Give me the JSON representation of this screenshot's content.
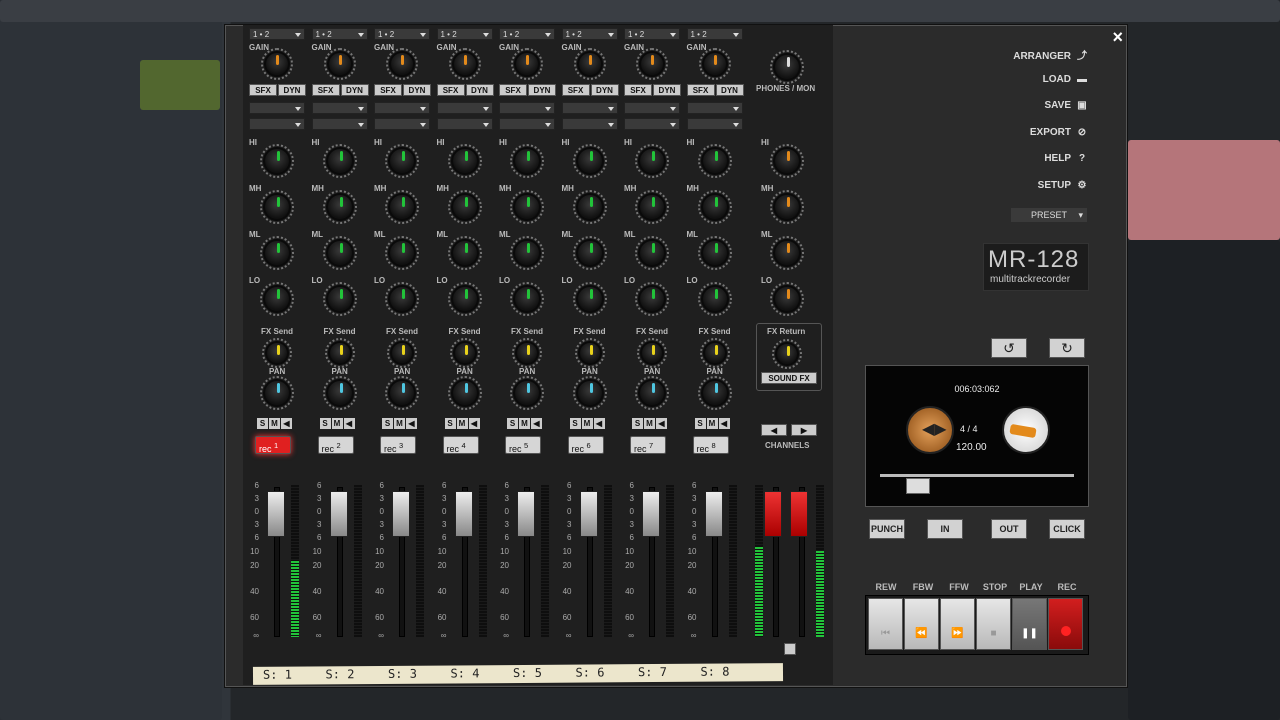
{
  "window": {
    "close_label": "×"
  },
  "channels": [
    {
      "input": "1 • 2",
      "rec_label": "rec",
      "rec_num": "1",
      "armed": true,
      "scribble": "S: 1"
    },
    {
      "input": "1 • 2",
      "rec_label": "rec",
      "rec_num": "2",
      "armed": false,
      "scribble": "S: 2"
    },
    {
      "input": "1 • 2",
      "rec_label": "rec",
      "rec_num": "3",
      "armed": false,
      "scribble": "S: 3"
    },
    {
      "input": "1 • 2",
      "rec_label": "rec",
      "rec_num": "4",
      "armed": false,
      "scribble": "S: 4"
    },
    {
      "input": "1 • 2",
      "rec_label": "rec",
      "rec_num": "5",
      "armed": false,
      "scribble": "S: 5"
    },
    {
      "input": "1 • 2",
      "rec_label": "rec",
      "rec_num": "6",
      "armed": false,
      "scribble": "S: 6"
    },
    {
      "input": "1 • 2",
      "rec_label": "rec",
      "rec_num": "7",
      "armed": false,
      "scribble": "S: 7"
    },
    {
      "input": "1 • 2",
      "rec_label": "rec",
      "rec_num": "8",
      "armed": false,
      "scribble": "S: 8"
    }
  ],
  "labels": {
    "gain": "GAIN",
    "sfx": "SFX",
    "dyn": "DYN",
    "hi": "HI",
    "mh": "MH",
    "ml": "ML",
    "lo": "LO",
    "fx_send": "FX Send",
    "pan": "PAN",
    "s": "S",
    "m": "M",
    "mon": "◀",
    "phones": "PHONES / MON",
    "fx_return": "FX Return",
    "sound_fx": "SOUND FX",
    "channels": "CHANNELS"
  },
  "fader_scale": [
    "6",
    "3",
    "0",
    "3",
    "6",
    "10",
    "20",
    "40",
    "60",
    "∞"
  ],
  "menu": [
    {
      "label": "ARRANGER",
      "icon": "⤴"
    },
    {
      "label": "LOAD",
      "icon": "▬"
    },
    {
      "label": "SAVE",
      "icon": "▣"
    },
    {
      "label": "EXPORT",
      "icon": "⊘"
    },
    {
      "label": "HELP",
      "icon": "?"
    },
    {
      "label": "SETUP",
      "icon": "⚙"
    }
  ],
  "preset": "PRESET",
  "logo": {
    "title": "MR-128",
    "subtitle": "multitrackrecorder"
  },
  "transport": {
    "time": "006:03:062",
    "signature": "4 / 4",
    "tempo": "120.00",
    "punch": "PUNCH",
    "in": "IN",
    "out": "OUT",
    "click": "CLICK",
    "rew": "REW",
    "fbw": "FBW",
    "ffw": "FFW",
    "stop": "STOP",
    "play": "PLAY",
    "rec": "REC"
  },
  "colors": {
    "accent_green": "#22c33a",
    "accent_orange": "#e38a1b",
    "rec_red": "#e02020"
  }
}
